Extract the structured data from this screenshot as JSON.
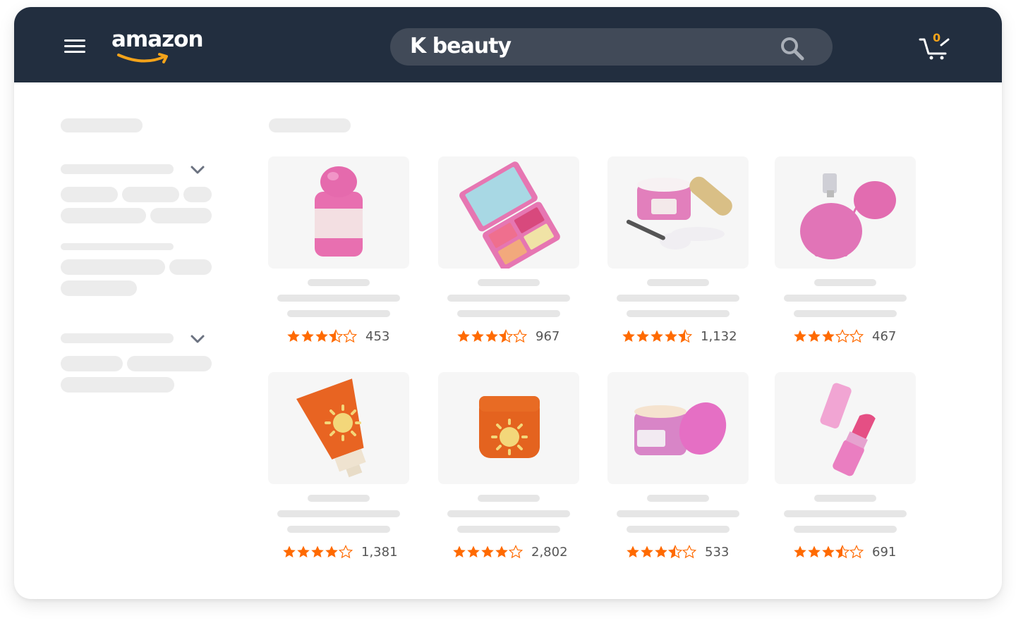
{
  "header": {
    "logo_text": "amazon",
    "search_query": "K beauty",
    "cart_count": "0",
    "colors": {
      "bar": "#222e3f",
      "search": "#414a58",
      "accent": "#f4a31a",
      "star": "#ff6a00"
    }
  },
  "icons": {
    "menu": "hamburger-icon",
    "search": "search-icon",
    "cart": "cart-icon",
    "chevron": "chevron-down-icon"
  },
  "products": [
    {
      "image": "pink-lotion-bottle",
      "rating": 3.5,
      "review_count": "453"
    },
    {
      "image": "eyeshadow-palette",
      "rating": 3.5,
      "review_count": "967"
    },
    {
      "image": "cream-jar-with-eye-patches",
      "rating": 4.5,
      "review_count": "1,132"
    },
    {
      "image": "perfume-atomizer",
      "rating": 3,
      "review_count": "467"
    },
    {
      "image": "sunscreen-tube",
      "rating": 4,
      "review_count": "1,381"
    },
    {
      "image": "sun-cream-jar",
      "rating": 4,
      "review_count": "2,802"
    },
    {
      "image": "pink-cream-jar",
      "rating": 3.5,
      "review_count": "533"
    },
    {
      "image": "lipstick",
      "rating": 3.5,
      "review_count": "691"
    }
  ]
}
